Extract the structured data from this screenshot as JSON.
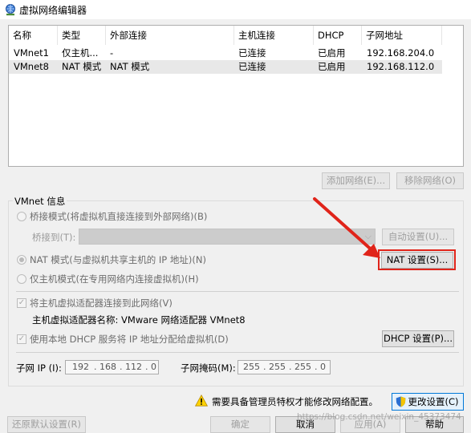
{
  "window": {
    "title": "虚拟网络编辑器"
  },
  "table": {
    "headers": [
      "名称",
      "类型",
      "外部连接",
      "主机连接",
      "DHCP",
      "子网地址"
    ],
    "rows": [
      [
        "VMnet1",
        "仅主机...",
        "-",
        "已连接",
        "已启用",
        "192.168.204.0"
      ],
      [
        "VMnet8",
        "NAT 模式",
        "NAT 模式",
        "已连接",
        "已启用",
        "192.168.112.0"
      ]
    ],
    "selected_row": 1
  },
  "list_buttons": {
    "add": "添加网络(E)...",
    "remove": "移除网络(O)"
  },
  "vmnet_info": {
    "title": "VMnet 信息",
    "bridge_mode": "桥接模式(将虚拟机直接连接到外部网络)(B)",
    "bridge_to_label": "桥接到(T):",
    "bridge_to_value": "",
    "auto_settings": "自动设置(U)...",
    "nat_mode": "NAT 模式(与虚拟机共享主机的 IP 地址)(N)",
    "nat_settings": "NAT 设置(S)...",
    "host_only": "仅主机模式(在专用网络内连接虚拟机)(H)",
    "connect_adapter": "将主机虚拟适配器连接到此网络(V)",
    "adapter_name": "主机虚拟适配器名称: VMware 网络适配器 VMnet8",
    "use_dhcp": "使用本地 DHCP 服务将 IP 地址分配给虚拟机(D)",
    "dhcp_settings": "DHCP 设置(P)...",
    "subnet_ip_label": "子网 IP (I):",
    "subnet_ip": [
      "192",
      "168",
      "112",
      "0"
    ],
    "subnet_mask_label": "子网掩码(M):",
    "subnet_mask": [
      "255",
      "255",
      "255",
      "0"
    ],
    "selected_mode": "nat",
    "connect_adapter_checked": true,
    "use_dhcp_checked": true
  },
  "admin": {
    "message": "需要具备管理员特权才能修改网络配置。",
    "change_settings": "更改设置(C)"
  },
  "footer": {
    "restore": "还原默认设置(R)",
    "ok": "确定",
    "cancel": "取消",
    "apply": "应用(A)",
    "help": "帮助"
  },
  "watermark": "https://blog.csdn.net/weixin_45373474",
  "colors": {
    "annotation": "#e0241a",
    "selected_row": "#e8e8e8",
    "default_button_border": "#0078d7"
  }
}
